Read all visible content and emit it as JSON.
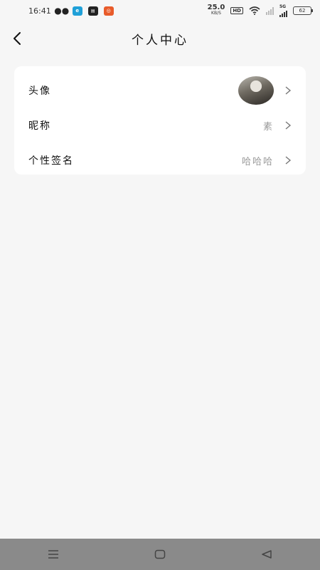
{
  "status_bar": {
    "time": "16:41",
    "net_speed_value": "25.0",
    "net_speed_unit": "KB/S",
    "hd_badge": "HD",
    "signal_label": "5G",
    "battery_level": "62",
    "app_icons": [
      "wechat-icon",
      "browser-icon",
      "news-app-icon",
      "orange-app-icon"
    ]
  },
  "header": {
    "title": "个人中心",
    "back_icon": "chevron-left-icon"
  },
  "profile": {
    "rows": [
      {
        "label": "头像",
        "value_type": "avatar"
      },
      {
        "label": "昵称",
        "value": "素"
      },
      {
        "label": "个性签名",
        "value": "哈哈哈"
      }
    ]
  },
  "nav_bar": {
    "buttons": [
      "menu-icon",
      "home-square-icon",
      "back-triangle-icon"
    ]
  },
  "colors": {
    "background": "#f6f6f6",
    "card": "#ffffff",
    "value_text": "#999999",
    "nav_bar": "#8a8a8a"
  }
}
